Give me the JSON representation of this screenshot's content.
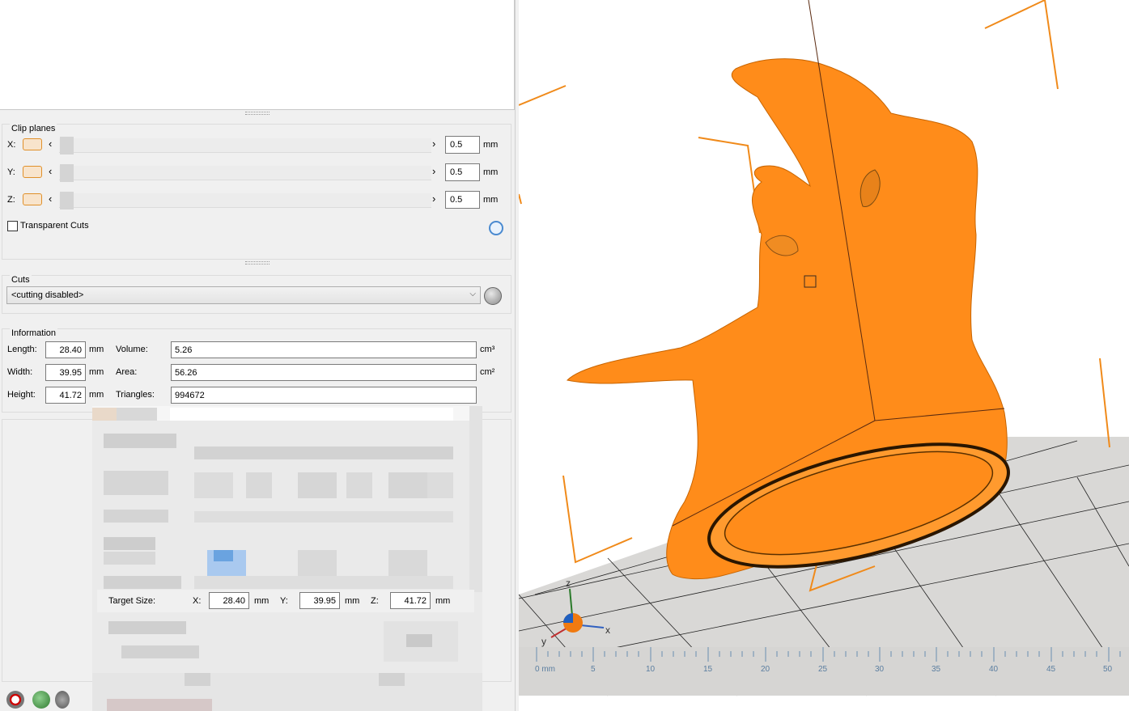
{
  "clip_planes": {
    "title": "Clip planes",
    "rows": [
      {
        "axis": "X:",
        "value": "0.5",
        "unit": "mm"
      },
      {
        "axis": "Y:",
        "value": "0.5",
        "unit": "mm"
      },
      {
        "axis": "Z:",
        "value": "0.5",
        "unit": "mm"
      }
    ],
    "transparent_cuts_label": "Transparent Cuts"
  },
  "cuts": {
    "title": "Cuts",
    "selected": "<cutting disabled>"
  },
  "information": {
    "title": "Information",
    "length_label": "Length:",
    "length_value": "28.40",
    "width_label": "Width:",
    "width_value": "39.95",
    "height_label": "Height:",
    "height_value": "41.72",
    "unit_mm": "mm",
    "volume_label": "Volume:",
    "volume_value": "5.26",
    "volume_unit": "cm³",
    "area_label": "Area:",
    "area_value": "56.26",
    "area_unit": "cm²",
    "triangles_label": "Triangles:",
    "triangles_value": "994672"
  },
  "scale_dialog": {
    "target_size_label": "Target Size:",
    "x_label": "X:",
    "x_value": "28.40",
    "y_label": "Y:",
    "y_value": "39.95",
    "z_label": "Z:",
    "z_value": "41.72",
    "unit": "mm"
  },
  "viewport": {
    "axis_x": "x",
    "axis_y": "y",
    "axis_z": "z",
    "ruler_ticks": [
      "0 mm",
      "5",
      "10",
      "15",
      "20",
      "25",
      "30",
      "35",
      "40",
      "45",
      "50"
    ],
    "model_color": "#ff8c00"
  }
}
